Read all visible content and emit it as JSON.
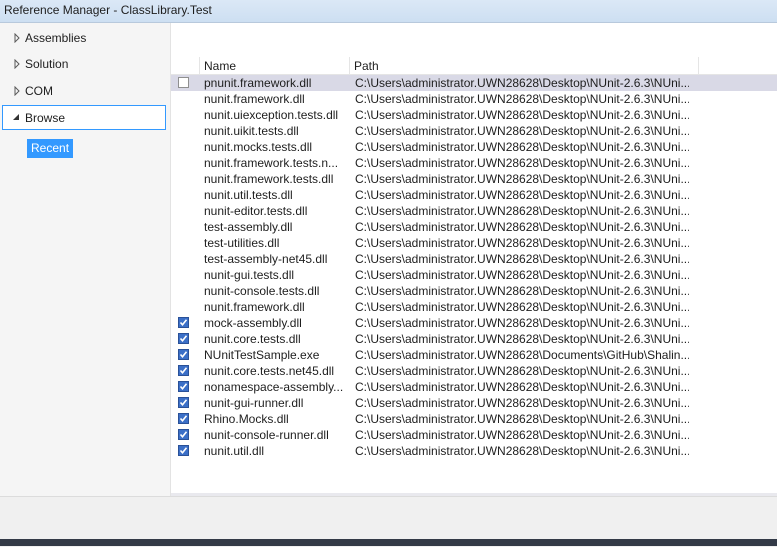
{
  "window": {
    "title": "Reference Manager - ClassLibrary.Test"
  },
  "sidebar": {
    "items": [
      {
        "label": "Assemblies",
        "expanded": false
      },
      {
        "label": "Solution",
        "expanded": false
      },
      {
        "label": "COM",
        "expanded": false
      },
      {
        "label": "Browse",
        "expanded": true
      }
    ],
    "sub_items": [
      {
        "label": "Recent",
        "selected": true
      }
    ]
  },
  "table": {
    "columns": [
      "Name",
      "Path"
    ],
    "rows": [
      {
        "checked": false,
        "name": "pnunit.framework.dll",
        "path": "C:\\Users\\administrator.UWN28628\\Desktop\\NUnit-2.6.3\\NUni..."
      },
      {
        "checked": null,
        "name": "nunit.framework.dll",
        "path": "C:\\Users\\administrator.UWN28628\\Desktop\\NUnit-2.6.3\\NUni..."
      },
      {
        "checked": null,
        "name": "nunit.uiexception.tests.dll",
        "path": "C:\\Users\\administrator.UWN28628\\Desktop\\NUnit-2.6.3\\NUni..."
      },
      {
        "checked": null,
        "name": "nunit.uikit.tests.dll",
        "path": "C:\\Users\\administrator.UWN28628\\Desktop\\NUnit-2.6.3\\NUni..."
      },
      {
        "checked": null,
        "name": "nunit.mocks.tests.dll",
        "path": "C:\\Users\\administrator.UWN28628\\Desktop\\NUnit-2.6.3\\NUni..."
      },
      {
        "checked": null,
        "name": "nunit.framework.tests.n...",
        "path": "C:\\Users\\administrator.UWN28628\\Desktop\\NUnit-2.6.3\\NUni..."
      },
      {
        "checked": null,
        "name": "nunit.framework.tests.dll",
        "path": "C:\\Users\\administrator.UWN28628\\Desktop\\NUnit-2.6.3\\NUni..."
      },
      {
        "checked": null,
        "name": "nunit.util.tests.dll",
        "path": "C:\\Users\\administrator.UWN28628\\Desktop\\NUnit-2.6.3\\NUni..."
      },
      {
        "checked": null,
        "name": "nunit-editor.tests.dll",
        "path": "C:\\Users\\administrator.UWN28628\\Desktop\\NUnit-2.6.3\\NUni..."
      },
      {
        "checked": null,
        "name": "test-assembly.dll",
        "path": "C:\\Users\\administrator.UWN28628\\Desktop\\NUnit-2.6.3\\NUni..."
      },
      {
        "checked": null,
        "name": "test-utilities.dll",
        "path": "C:\\Users\\administrator.UWN28628\\Desktop\\NUnit-2.6.3\\NUni..."
      },
      {
        "checked": null,
        "name": "test-assembly-net45.dll",
        "path": "C:\\Users\\administrator.UWN28628\\Desktop\\NUnit-2.6.3\\NUni..."
      },
      {
        "checked": null,
        "name": "nunit-gui.tests.dll",
        "path": "C:\\Users\\administrator.UWN28628\\Desktop\\NUnit-2.6.3\\NUni..."
      },
      {
        "checked": null,
        "name": "nunit-console.tests.dll",
        "path": "C:\\Users\\administrator.UWN28628\\Desktop\\NUnit-2.6.3\\NUni..."
      },
      {
        "checked": null,
        "name": "nunit.framework.dll",
        "path": "C:\\Users\\administrator.UWN28628\\Desktop\\NUnit-2.6.3\\NUni..."
      },
      {
        "checked": true,
        "name": "mock-assembly.dll",
        "path": "C:\\Users\\administrator.UWN28628\\Desktop\\NUnit-2.6.3\\NUni..."
      },
      {
        "checked": true,
        "name": "nunit.core.tests.dll",
        "path": "C:\\Users\\administrator.UWN28628\\Desktop\\NUnit-2.6.3\\NUni..."
      },
      {
        "checked": true,
        "name": "NUnitTestSample.exe",
        "path": "C:\\Users\\administrator.UWN28628\\Documents\\GitHub\\Shalin..."
      },
      {
        "checked": true,
        "name": "nunit.core.tests.net45.dll",
        "path": "C:\\Users\\administrator.UWN28628\\Desktop\\NUnit-2.6.3\\NUni..."
      },
      {
        "checked": true,
        "name": "nonamespace-assembly...",
        "path": "C:\\Users\\administrator.UWN28628\\Desktop\\NUnit-2.6.3\\NUni..."
      },
      {
        "checked": true,
        "name": "nunit-gui-runner.dll",
        "path": "C:\\Users\\administrator.UWN28628\\Desktop\\NUnit-2.6.3\\NUni..."
      },
      {
        "checked": true,
        "name": "Rhino.Mocks.dll",
        "path": "C:\\Users\\administrator.UWN28628\\Desktop\\NUnit-2.6.3\\NUni..."
      },
      {
        "checked": true,
        "name": "nunit-console-runner.dll",
        "path": "C:\\Users\\administrator.UWN28628\\Desktop\\NUnit-2.6.3\\NUni..."
      },
      {
        "checked": true,
        "name": "nunit.util.dll",
        "path": "C:\\Users\\administrator.UWN28628\\Desktop\\NUnit-2.6.3\\NUni..."
      }
    ]
  },
  "colors": {
    "accent": "#3399ff",
    "checkbox_checked": "#3b6fc7",
    "hover_row": "#d9d9e6"
  }
}
